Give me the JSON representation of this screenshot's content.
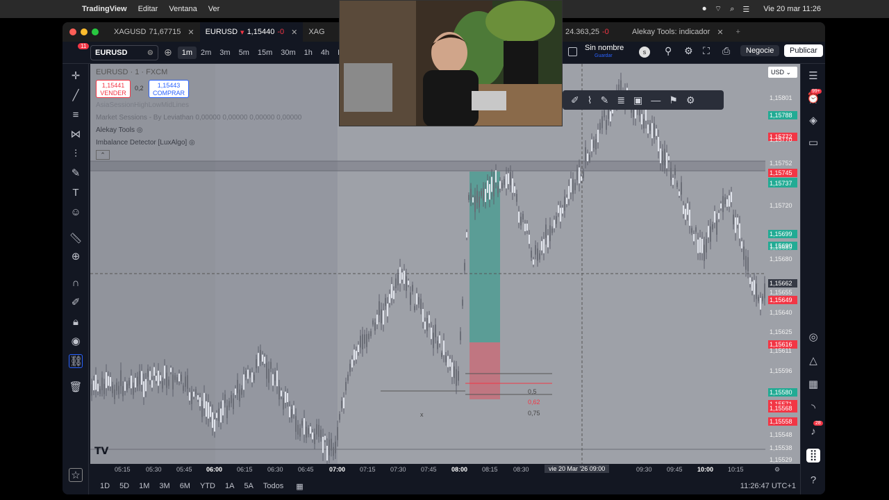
{
  "menubar": {
    "app": "TradingView",
    "items": [
      "Editar",
      "Ventana",
      "Ver"
    ],
    "clock": "Vie 20 mar 11:26"
  },
  "tabs": [
    {
      "symbol": "XAGUSD",
      "price": "71,67715"
    },
    {
      "symbol": "EURUSD",
      "price": "1,15440",
      "change": "-0"
    },
    {
      "symbol": "XAG"
    },
    {
      "symbol": "",
      "price": "24.363,25",
      "change": "-0"
    },
    {
      "title": "Alekay Tools: indicador"
    }
  ],
  "toolbar": {
    "notification_count": "11",
    "symbol": "EURUSD",
    "timeframes": [
      "1m",
      "2m",
      "3m",
      "5m",
      "15m",
      "30m",
      "1h",
      "4h",
      "D",
      "S"
    ],
    "layout_name": "Sin nombre",
    "save_hint": "Guardar",
    "trade_button": "Negocie",
    "publish_button": "Publicar"
  },
  "chart": {
    "title": "EURUSD · 1 · FXCM",
    "sell_price": "1,15441",
    "sell_label": "VENDER",
    "spread": "0,2",
    "buy_price": "1,15443",
    "buy_label": "COMPRAR",
    "indicators": [
      "AsiaSessionHighLowMidLines",
      "Market Sessions - By Leviathan",
      "Alekay Tools",
      "Imbalance Detector [LuxAlgo]"
    ],
    "sessions_values": "0,00000  0,00000  0,00000  0,00000",
    "currency": "USD",
    "crosshair_price": "1,15662",
    "crosshair_time": "vie 20 Mar '26  09:00",
    "fib_levels": [
      "0,5",
      "0,62",
      "0,75"
    ],
    "fib_marker": "x"
  },
  "price_axis": [
    {
      "v": "1,15801",
      "style": "plain"
    },
    {
      "v": "1,15788",
      "style": "green"
    },
    {
      "v": "1,15772",
      "style": "red"
    },
    {
      "v": "1,15770",
      "style": "plain"
    },
    {
      "v": "1,15752",
      "style": "plain"
    },
    {
      "v": "1,15745",
      "style": "red"
    },
    {
      "v": "1,15738",
      "style": "green"
    },
    {
      "v": "1,15737",
      "style": "green"
    },
    {
      "v": "1,15720",
      "style": "plain"
    },
    {
      "v": "1,15699",
      "style": "green"
    },
    {
      "v": "1,15690",
      "style": "green"
    },
    {
      "v": "1,15689",
      "style": "plain"
    },
    {
      "v": "1,15680",
      "style": "plain"
    },
    {
      "v": "1,15662",
      "style": "dark"
    },
    {
      "v": "1,15655",
      "style": "plain"
    },
    {
      "v": "1,15649",
      "style": "red"
    },
    {
      "v": "1,15640",
      "style": "plain"
    },
    {
      "v": "1,15625",
      "style": "plain"
    },
    {
      "v": "1,15616",
      "style": "red"
    },
    {
      "v": "1,15611",
      "style": "plain"
    },
    {
      "v": "1,15596",
      "style": "plain"
    },
    {
      "v": "1,15580",
      "style": "green"
    },
    {
      "v": "1,15571",
      "style": "red"
    },
    {
      "v": "1,15568",
      "style": "red"
    },
    {
      "v": "1,15558",
      "style": "red"
    },
    {
      "v": "1,15548",
      "style": "plain"
    },
    {
      "v": "1,15538",
      "style": "plain"
    },
    {
      "v": "1,15529",
      "style": "plain"
    }
  ],
  "time_axis": [
    "05:15",
    "05:30",
    "05:45",
    "06:00",
    "06:15",
    "06:30",
    "06:45",
    "07:00",
    "07:15",
    "07:30",
    "07:45",
    "08:00",
    "08:15",
    "08:30",
    "09:30",
    "09:45",
    "10:00",
    "10:15"
  ],
  "bottombar": {
    "ranges": [
      "1D",
      "5D",
      "1M",
      "3M",
      "6M",
      "YTD",
      "1A",
      "5A",
      "Todos"
    ],
    "clock": "11:26:47 UTC+1"
  },
  "right_badges": {
    "alerts": "99+",
    "notifications": "28"
  },
  "colors": {
    "bg": "#131722",
    "bull": "#089981",
    "bear": "#f23645",
    "accent": "#2962ff"
  }
}
